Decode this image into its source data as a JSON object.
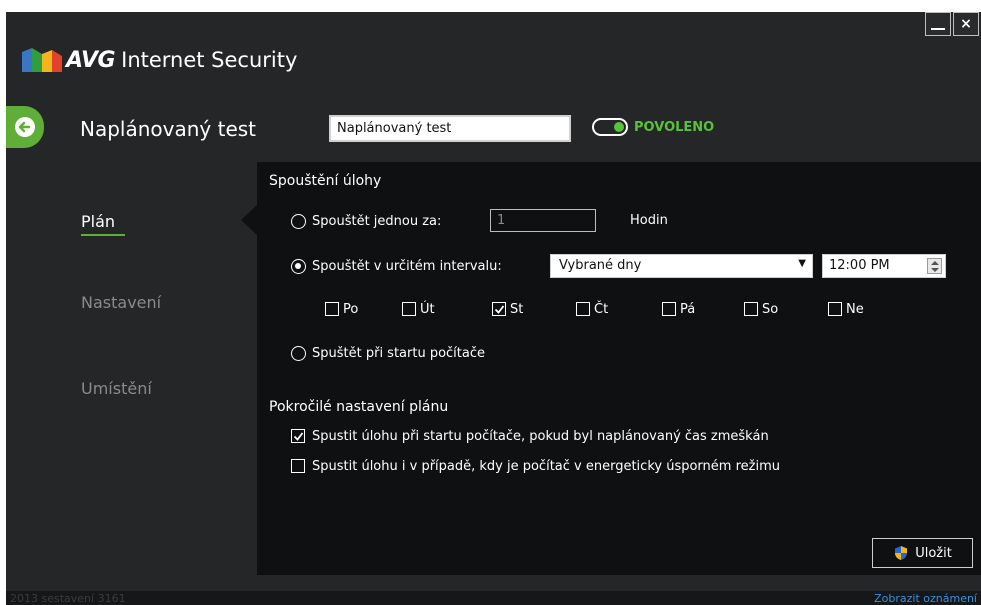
{
  "app": {
    "brand": "AVG",
    "product": "Internet Security"
  },
  "window_controls": {
    "minimize_icon": "minimize-icon",
    "close_label": "×"
  },
  "header": {
    "title": "Naplánovaný test",
    "name_value": "Naplánovaný test",
    "toggle_label": "POVOLENO",
    "toggle_on": true
  },
  "nav": {
    "items": [
      {
        "label": "Plán",
        "active": true
      },
      {
        "label": "Nastavení",
        "active": false
      },
      {
        "label": "Umístění",
        "active": false
      }
    ]
  },
  "run": {
    "heading": "Spouštění úlohy",
    "once_label": "Spouštět jednou za:",
    "once_value": "1",
    "once_unit": "Hodin",
    "interval_label": "Spouštět v určitém intervalu:",
    "interval_select": "Vybrané dny",
    "time_value": "12:00 PM",
    "days": [
      {
        "label": "Po",
        "checked": false
      },
      {
        "label": "Út",
        "checked": false
      },
      {
        "label": "St",
        "checked": true
      },
      {
        "label": "Čt",
        "checked": false
      },
      {
        "label": "Pá",
        "checked": false
      },
      {
        "label": "So",
        "checked": false
      },
      {
        "label": "Ne",
        "checked": false
      }
    ],
    "startup_label": "Spuštět při startu počítače",
    "selected_option": "interval"
  },
  "advanced": {
    "heading": "Pokročilé nastavení plánu",
    "options": [
      {
        "label": "Spustit úlohu při startu počítače, pokud byl naplánovaný čas zmeškán",
        "checked": true
      },
      {
        "label": "Spustit úlohu i v případě, kdy je počítač v energeticky úsporném režimu",
        "checked": false
      }
    ]
  },
  "save_label": "Uložit",
  "footer": {
    "build": "2013 sestavení 3161",
    "notifications": "Zobrazit oznámení"
  },
  "colors": {
    "accent_green": "#5fae37",
    "toggle_green": "#58c23a",
    "panel_bg": "#0f1012",
    "window_bg": "#252628",
    "link_blue": "#3b8fe0"
  }
}
